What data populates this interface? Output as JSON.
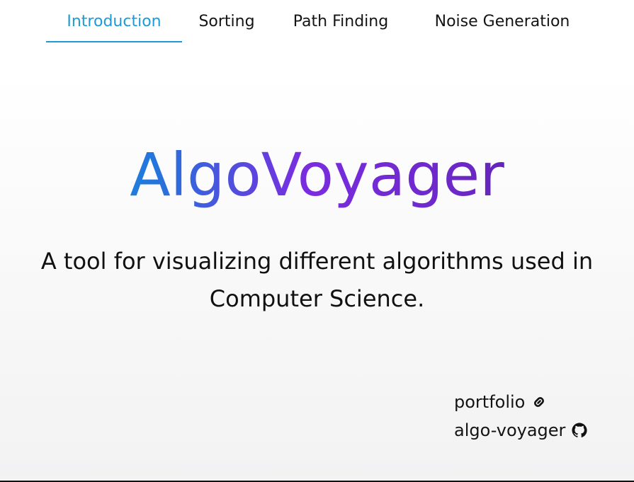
{
  "nav": {
    "tabs": [
      {
        "label": "Introduction",
        "active": true
      },
      {
        "label": "Sorting",
        "active": false
      },
      {
        "label": "Path Finding",
        "active": false
      },
      {
        "label": "Noise Generation",
        "active": false
      }
    ],
    "active_color": "#1e9bd7"
  },
  "hero": {
    "title": "AlgoVoyager",
    "gradient_colors": [
      "#1a9ede",
      "#2276dc",
      "#7a2ce0",
      "#6c28c8",
      "#4f1a96"
    ]
  },
  "subtitle": "A tool for visualizing different algorithms used in Computer Science.",
  "links": [
    {
      "label": "portfolio",
      "icon": "link-icon"
    },
    {
      "label": "algo-voyager",
      "icon": "github-icon"
    }
  ]
}
